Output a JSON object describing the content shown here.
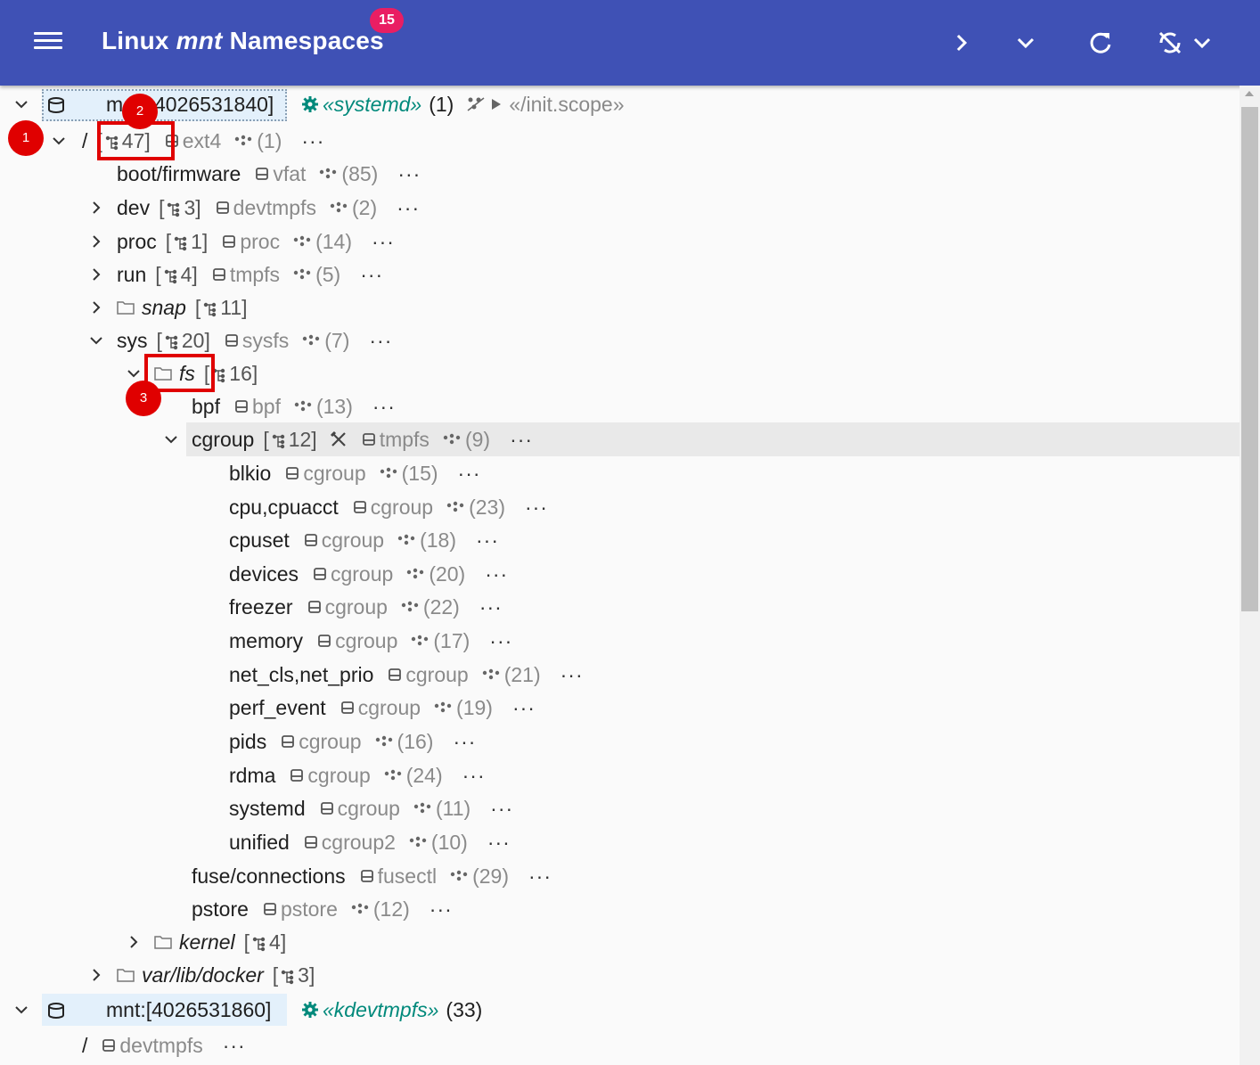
{
  "appbar": {
    "title_prefix": "Linux",
    "title_mid": "mnt",
    "title_suffix": "Namespaces",
    "badge": "15",
    "color": "#3f51b5",
    "badge_color": "#e91e63"
  },
  "namespaces": [
    {
      "label_a": "m",
      "label_b": "4026531840]",
      "process": "«systemd»",
      "process_count": "(1)",
      "cgroup": "«/init.scope»"
    },
    {
      "label": "mnt:[4026531860]",
      "process": "«kdevtmpfs»",
      "process_count": "(33)"
    }
  ],
  "tree": [
    {
      "name": "/",
      "mounts": "47]",
      "fs": "ext4",
      "count": "(1)"
    },
    {
      "name": "boot/firmware",
      "fs": "vfat",
      "count": "(85)"
    },
    {
      "name": "dev",
      "mounts": "3]",
      "fs": "devtmpfs",
      "count": "(2)"
    },
    {
      "name": "proc",
      "mounts": "1]",
      "fs": "proc",
      "count": "(14)"
    },
    {
      "name": "run",
      "mounts": "4]",
      "fs": "tmpfs",
      "count": "(5)"
    },
    {
      "name": "snap",
      "mounts": "11]"
    },
    {
      "name": "sys",
      "mounts": "20]",
      "fs": "sysfs",
      "count": "(7)"
    },
    {
      "name": "fs",
      "mounts": "16]"
    },
    {
      "name": "bpf",
      "fs": "bpf",
      "count": "(13)"
    },
    {
      "name": "cgroup",
      "mounts": "12]",
      "fs": "tmpfs",
      "count": "(9)"
    },
    {
      "name": "blkio",
      "fs": "cgroup",
      "count": "(15)"
    },
    {
      "name": "cpu,cpuacct",
      "fs": "cgroup",
      "count": "(23)"
    },
    {
      "name": "cpuset",
      "fs": "cgroup",
      "count": "(18)"
    },
    {
      "name": "devices",
      "fs": "cgroup",
      "count": "(20)"
    },
    {
      "name": "freezer",
      "fs": "cgroup",
      "count": "(22)"
    },
    {
      "name": "memory",
      "fs": "cgroup",
      "count": "(17)"
    },
    {
      "name": "net_cls,net_prio",
      "fs": "cgroup",
      "count": "(21)"
    },
    {
      "name": "perf_event",
      "fs": "cgroup",
      "count": "(19)"
    },
    {
      "name": "pids",
      "fs": "cgroup",
      "count": "(16)"
    },
    {
      "name": "rdma",
      "fs": "cgroup",
      "count": "(24)"
    },
    {
      "name": "systemd",
      "fs": "cgroup",
      "count": "(11)"
    },
    {
      "name": "unified",
      "fs": "cgroup2",
      "count": "(10)"
    },
    {
      "name": "fuse/connections",
      "fs": "fusectl",
      "count": "(29)"
    },
    {
      "name": "pstore",
      "fs": "pstore",
      "count": "(12)"
    },
    {
      "name": "kernel",
      "mounts": "4]"
    },
    {
      "name": "var/lib/docker",
      "mounts": "3]"
    },
    {
      "name": "/",
      "fs": "devtmpfs"
    }
  ],
  "more": "···",
  "bracket_open": "[",
  "markers": [
    "1",
    "2",
    "3"
  ],
  "annotation_color": "#e00000"
}
